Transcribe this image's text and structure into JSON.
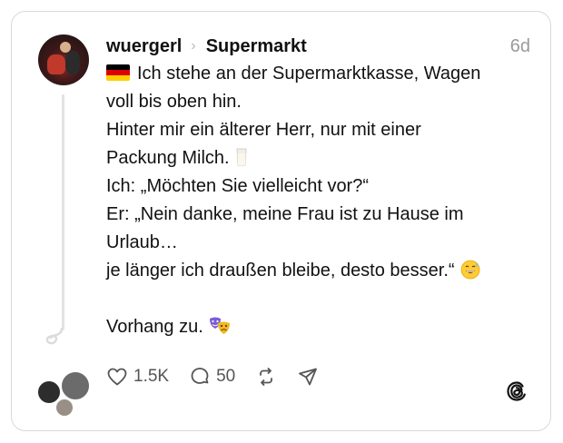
{
  "post": {
    "username": "wuergerl",
    "separator": "›",
    "topic": "Supermarkt",
    "age": "6d",
    "lines": [
      "Ich stehe an der Supermarktkasse, Wagen",
      "voll bis oben hin.",
      "Hinter mir ein älterer Herr, nur mit einer",
      "Packung Milch.",
      "Ich: „Möchten Sie vielleicht vor?“",
      "Er: „Nein danke, meine Frau ist zu Hause im",
      "Urlaub…",
      "je länger ich draußen bleibe, desto besser.“",
      "",
      "Vorhang zu."
    ]
  },
  "actions": {
    "likes": "1.5K",
    "comments": "50"
  },
  "icons": {
    "flag": "germany-flag-icon",
    "milk": "glass-of-milk-icon",
    "sweat": "grinning-sweat-icon",
    "masks": "performing-arts-icon",
    "like": "heart-icon",
    "comment": "comment-icon",
    "repost": "repost-icon",
    "share": "send-icon",
    "brand": "threads-logo-icon"
  },
  "colors": {
    "text": "#111111",
    "muted": "#9a9a9a",
    "border": "#d9d9d9"
  }
}
